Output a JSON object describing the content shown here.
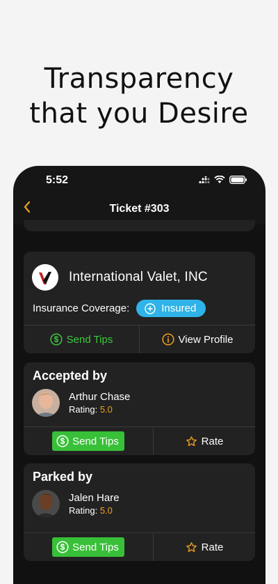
{
  "headline": {
    "line1": "Transparency",
    "line2": "that you Desire"
  },
  "status_bar": {
    "time": "5:52"
  },
  "nav": {
    "back_icon": "chevron-left",
    "title": "Ticket #303"
  },
  "company": {
    "name": "International Valet, INC",
    "insurance_label": "Insurance Coverage:",
    "insurance_status": "Insured",
    "send_tips_label": "Send Tips",
    "view_profile_label": "View Profile"
  },
  "accepted": {
    "title": "Accepted by",
    "name": "Arthur Chase",
    "rating_label": "Rating:",
    "rating_value": "5.0",
    "send_tips_label": "Send Tips",
    "rate_label": "Rate"
  },
  "parked": {
    "title": "Parked by",
    "name": "Jalen Hare",
    "rating_label": "Rating:",
    "rating_value": "5.0",
    "send_tips_label": "Send Tips",
    "rate_label": "Rate"
  },
  "colors": {
    "accent": "#f0a020",
    "green": "#38c038",
    "insured_blue": "#2fb3e8",
    "card_bg": "#222222"
  }
}
